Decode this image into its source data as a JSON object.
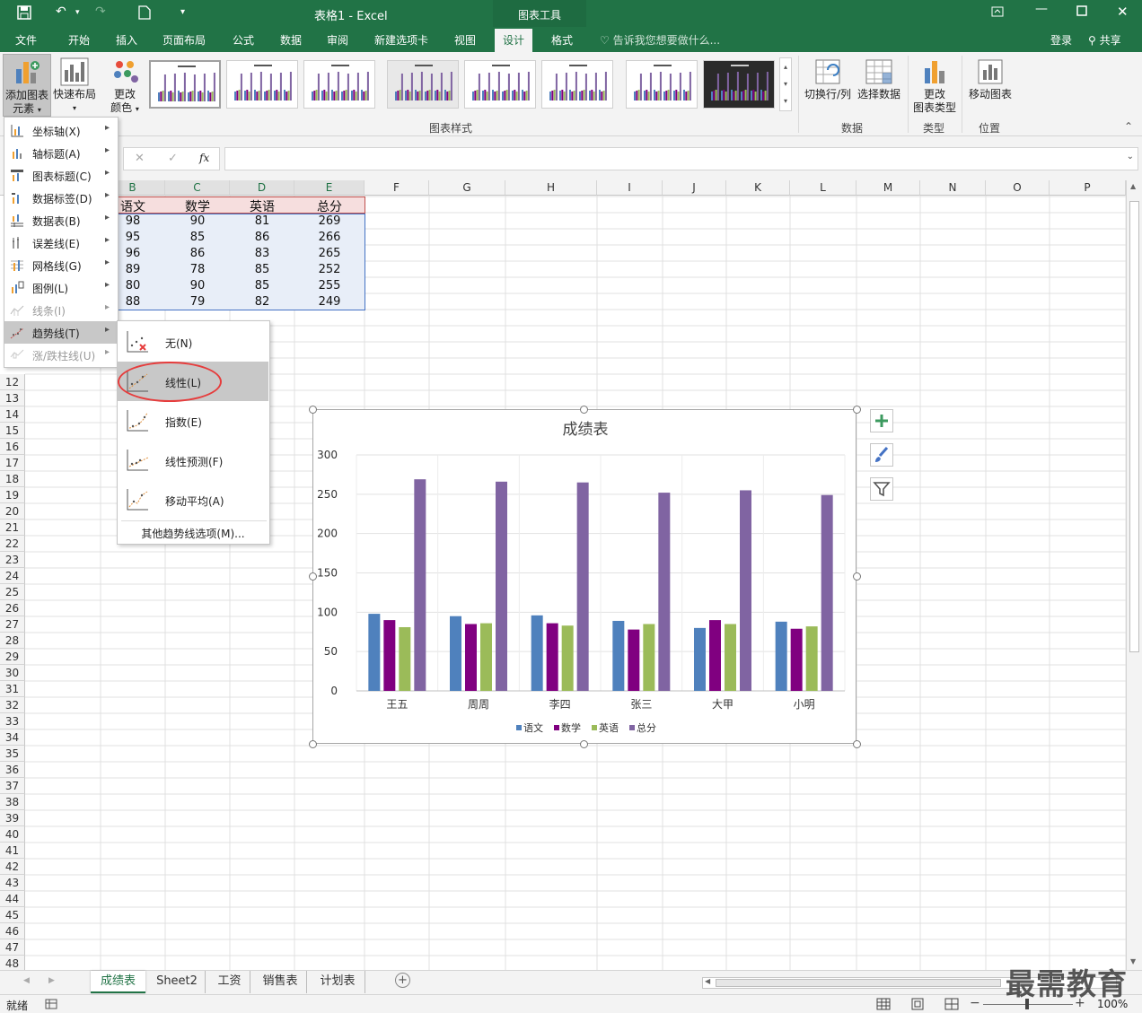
{
  "window": {
    "title": "表格1 - Excel",
    "tool_context": "图表工具",
    "restore_icon": "ribbon-display-icon"
  },
  "tabs": {
    "file": "文件",
    "home": "开始",
    "insert": "插入",
    "layout": "页面布局",
    "formulas": "公式",
    "data": "数据",
    "review": "审阅",
    "newtab": "新建选项卡",
    "view": "视图",
    "design": "设计",
    "format": "格式",
    "tellme": "告诉我您想要做什么...",
    "signin": "登录",
    "share": "共享"
  },
  "ribbon": {
    "add_element_1": "添加图表",
    "add_element_2": "元素",
    "quick_layout": "快速布局",
    "change_color_1": "更改",
    "change_color_2": "颜色",
    "chart_styles_label": "图表样式",
    "switch_rowcol": "切换行/列",
    "select_data": "选择数据",
    "data_label": "数据",
    "change_type_1": "更改",
    "change_type_2": "图表类型",
    "type_label": "类型",
    "move_chart": "移动图表",
    "location_label": "位置"
  },
  "formula": {
    "cancel": "✕",
    "enter": "✓",
    "fx": "fx",
    "value": ""
  },
  "columns": [
    "B",
    "C",
    "D",
    "E",
    "F",
    "G",
    "H",
    "I",
    "J",
    "K",
    "L",
    "M",
    "N",
    "O",
    "P"
  ],
  "rows": [
    "12",
    "13",
    "14",
    "15",
    "16",
    "17",
    "18",
    "19",
    "20",
    "21",
    "22",
    "23",
    "24",
    "25",
    "26",
    "27",
    "28",
    "29",
    "30",
    "31",
    "32",
    "33",
    "34",
    "35",
    "36",
    "37",
    "38",
    "39",
    "40",
    "41",
    "42",
    "43",
    "44",
    "45",
    "46",
    "47",
    "48"
  ],
  "table": {
    "headers": [
      "语文",
      "数学",
      "英语",
      "总分"
    ],
    "rows": [
      [
        "98",
        "90",
        "81",
        "269"
      ],
      [
        "95",
        "85",
        "86",
        "266"
      ],
      [
        "96",
        "86",
        "83",
        "265"
      ],
      [
        "89",
        "78",
        "85",
        "252"
      ],
      [
        "80",
        "90",
        "85",
        "255"
      ],
      [
        "88",
        "79",
        "82",
        "249"
      ]
    ]
  },
  "menu": {
    "items": [
      {
        "label": "坐标轴(X)",
        "disabled": false,
        "icon": "axis-icon"
      },
      {
        "label": "轴标题(A)",
        "disabled": false,
        "icon": "axis-title-icon"
      },
      {
        "label": "图表标题(C)",
        "disabled": false,
        "icon": "chart-title-icon"
      },
      {
        "label": "数据标签(D)",
        "disabled": false,
        "icon": "data-label-icon"
      },
      {
        "label": "数据表(B)",
        "disabled": false,
        "icon": "data-table-icon"
      },
      {
        "label": "误差线(E)",
        "disabled": false,
        "icon": "error-bar-icon"
      },
      {
        "label": "网格线(G)",
        "disabled": false,
        "icon": "gridline-icon"
      },
      {
        "label": "图例(L)",
        "disabled": false,
        "icon": "legend-icon"
      },
      {
        "label": "线条(I)",
        "disabled": true,
        "icon": "lines-icon"
      },
      {
        "label": "趋势线(T)",
        "disabled": false,
        "icon": "trendline-icon"
      },
      {
        "label": "涨/跌柱线(U)",
        "disabled": true,
        "icon": "updown-bar-icon"
      }
    ]
  },
  "submenu": {
    "items": [
      {
        "label": "无(N)",
        "icon": "trend-none-icon"
      },
      {
        "label": "线性(L)",
        "icon": "trend-linear-icon"
      },
      {
        "label": "指数(E)",
        "icon": "trend-exponential-icon"
      },
      {
        "label": "线性预测(F)",
        "icon": "trend-forecast-icon"
      },
      {
        "label": "移动平均(A)",
        "icon": "trend-moving-avg-icon"
      }
    ],
    "more": "其他趋势线选项(M)..."
  },
  "colors": {
    "excel_green": "#217346",
    "s1": "#4f81bd",
    "s2": "#800080",
    "s3": "#9bbb59",
    "s4": "#8064a2",
    "highlight": "#e63c3c"
  },
  "chart_data": {
    "type": "bar",
    "title": "成绩表",
    "categories": [
      "王五",
      "周周",
      "李四",
      "张三",
      "大甲",
      "小明"
    ],
    "series": [
      {
        "name": "语文",
        "values": [
          98,
          95,
          96,
          89,
          80,
          88
        ]
      },
      {
        "name": "数学",
        "values": [
          90,
          85,
          86,
          78,
          90,
          79
        ]
      },
      {
        "name": "英语",
        "values": [
          81,
          86,
          83,
          85,
          85,
          82
        ]
      },
      {
        "name": "总分",
        "values": [
          269,
          266,
          265,
          252,
          255,
          249
        ]
      }
    ],
    "ylim": [
      0,
      300
    ],
    "yticks": [
      "0",
      "50",
      "100",
      "150",
      "200",
      "250",
      "300"
    ],
    "grid": true,
    "legend": "bottom"
  },
  "sheets": [
    "成绩表",
    "Sheet2",
    "工资",
    "销售表",
    "计划表"
  ],
  "status": {
    "ready": "就绪",
    "zoom": "100%"
  },
  "watermark": "最需教育"
}
